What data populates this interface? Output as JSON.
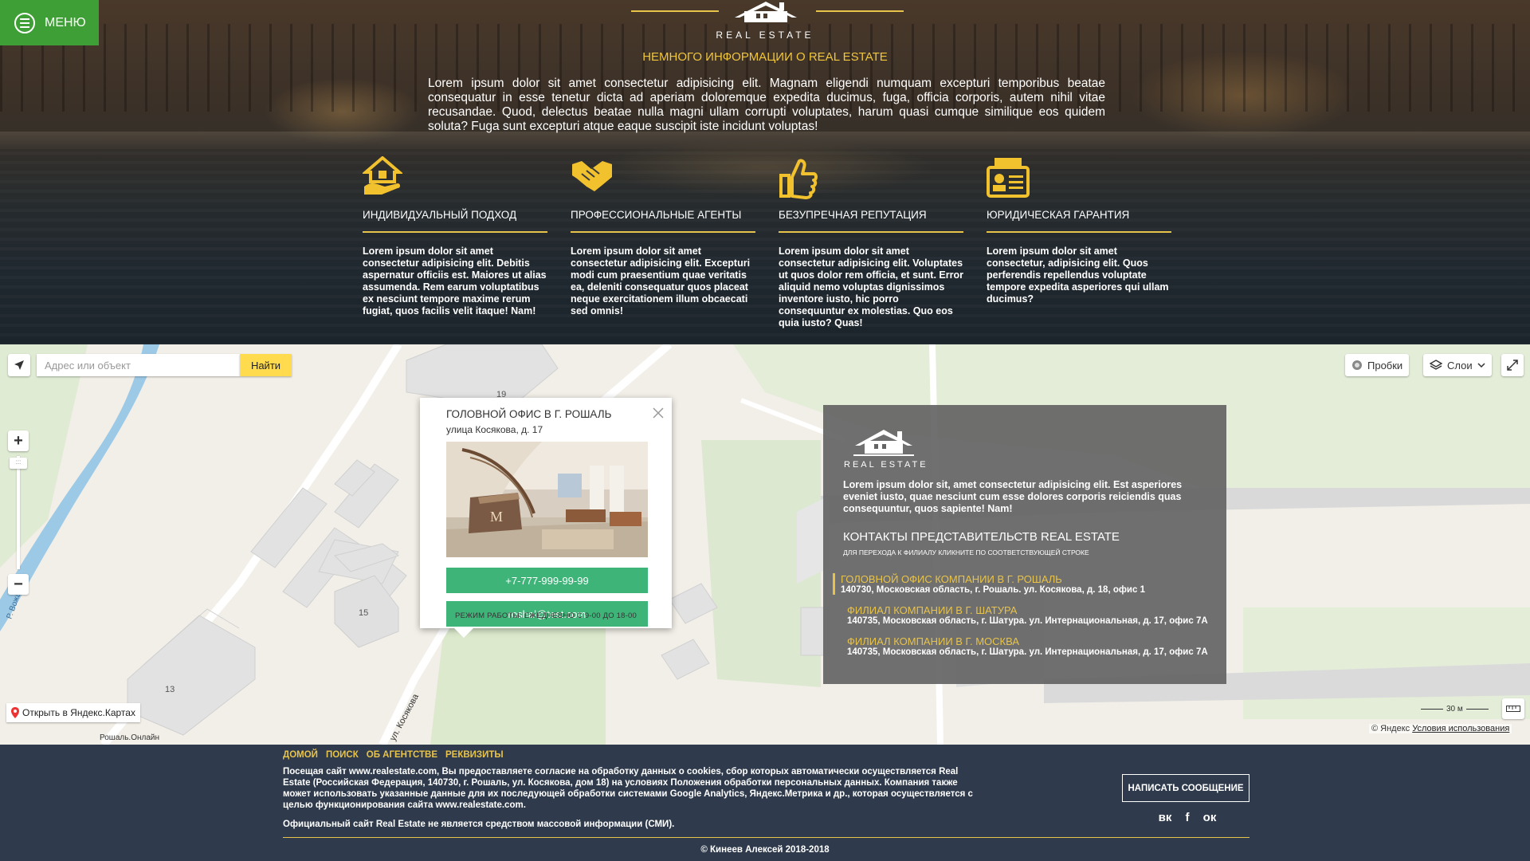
{
  "menu": {
    "label": "МЕНЮ"
  },
  "hero": {
    "brand": "REAL ESTATE",
    "subtitle": "НЕМНОГО ИНФОРМАЦИИ О REAL ESTATE",
    "text": "Lorem ipsum dolor sit amet consectetur adipisicing elit. Magnam eligendi numquam excepturi temporibus beatae consequatur in esse tenetur dicta ad aperiam doloremque expedita ducimus, fuga, officia corporis, autem nihil vitae recusandae. Quod, delectus beatae nulla magni ullam corrupti voluptates, harum quasi cumque similique eos quidem soluta? Fuga sunt excepturi atque eaque suscipit iste incidunt voluptas!",
    "features": [
      {
        "icon": "house-hand-icon",
        "title": "ИНДИВИДУАЛЬНЫЙ ПОДХОД",
        "text": "Lorem ipsum dolor sit amet consectetur adipisicing elit. Debitis aspernatur officiis est. Maiores ut alias assumenda. Rem earum voluptatibus ex nesciunt tempore maxime rerum fugiat, quos facilis velit itaque! Nam!"
      },
      {
        "icon": "handshake-icon",
        "title": "ПРОФЕССИОНАЛЬНЫЕ АГЕНТЫ",
        "text": "Lorem ipsum dolor sit amet consectetur adipisicing elit. Excepturi modi cum praesentium quae veritatis ea, deleniti consequatur quos placeat neque exercitationem illum obcaecati sed omnis!"
      },
      {
        "icon": "thumbs-up-icon",
        "title": "БЕЗУПРЕЧНАЯ РЕПУТАЦИЯ",
        "text": "Lorem ipsum dolor sit amet consectetur adipisicing elit. Voluptates ut quos dolor rem officia, et sunt. Error aliquid nemo voluptas dignissimos inventore iusto, hic porro consequuntur ex molestias. Quo eos quia iusto? Quas!"
      },
      {
        "icon": "id-card-icon",
        "title": "ЮРИДИЧЕСКАЯ ГАРАНТИЯ",
        "text": "Lorem ipsum dolor sit amet consectetur, adipisicing elit. Quos perferendis repellendus voluptate tempore expedita asperiores qui ullam ducimus?"
      }
    ]
  },
  "map": {
    "search_placeholder": "Адрес или объект",
    "search_button": "Найти",
    "traffic": "Пробки",
    "layers": "Слои",
    "open_yandex": "Открыть в Яндекс.Картах",
    "small_label": "Рошаль.Онлайн",
    "scale": "30 м",
    "copyright": "© Яндекс",
    "terms": "Условия использования",
    "labels": {
      "b19": "19",
      "b15": "15",
      "b13": "13",
      "street": "ул. Косякова",
      "river": "Р. Вожа"
    }
  },
  "balloon": {
    "title": "ГОЛОВНОЙ ОФИС В Г. РОШАЛЬ",
    "address": "улица Косякова, д. 17",
    "phone": "+7-777-999-99-99",
    "email": "roshal@test.com",
    "hours": "РЕЖИМ РАБОТЫ: ЕЖЕДНЕВНО С 9-00 ДО 18-00"
  },
  "contacts": {
    "brand": "REAL ESTATE",
    "intro": "Lorem ipsum dolor sit, amet consectetur adipisicing elit. Est asperiores eveniet iusto, quae nesciunt cum esse dolores corporis reiciendis quas consequuntur, quos sapiente! Nam!",
    "heading": "КОНТАКТЫ ПРЕДСТАВИТЕЛЬСТВ REAL ESTATE",
    "hint": "ДЛЯ ПЕРЕХОДА К ФИЛИАЛУ КЛИКНИТЕ ПО СООТВЕТСТВУЮЩЕЙ СТРОКЕ",
    "offices": [
      {
        "name": "ГОЛОВНОЙ ОФИС КОМПАНИИ В Г. РОШАЛЬ",
        "address": "140730, Московская область, г. Рошаль. ул. Косякова, д. 18, офис 1"
      },
      {
        "name": "ФИЛИАЛ КОМПАНИИ В Г. ШАТУРА",
        "address": "140735, Московская область, г. Шатура. ул. Интернациональная, д. 17, офис 7А"
      },
      {
        "name": "ФИЛИАЛ КОМПАНИИ В Г. МОСКВА",
        "address": "140735, Московская область, г. Шатура. ул. Интернациональная, д. 17, офис 7А"
      }
    ]
  },
  "footer": {
    "nav": [
      "ДОМОЙ",
      "ПОИСК",
      "ОБ АГЕНТСТВЕ",
      "РЕКВИЗИТЫ"
    ],
    "legal": "Посещая сайт www.realestate.com, Вы предоставляете согласие на обработку данных о cookies, сбор которых автоматически осуществляется Real Estate (Российская Федерация, 140730, г. Рошаль, ул. Косякова, дом 18) на условиях Положения обработки персональных данных. Компания также может использовать указанные данные для их последующей обработки системами Google Analytics, Яндекс.Метрика и др., которая осуществляется с целью функционирования сайта www.realestate.com.",
    "smi": "Официальный сайт Real Estate не является средством массовой информации (СМИ).",
    "write_button": "НАПИСАТЬ СООБЩЕНИЕ",
    "social": {
      "vk": "вк",
      "fb": "f",
      "ok": "ок"
    },
    "copyright": "© Кинеев Алексей 2018-2018"
  },
  "colors": {
    "accent_yellow": "#e8c34a",
    "menu_green": "#3f9f37",
    "button_green": "#3fb479",
    "footer_bg": "#2f3b4c"
  }
}
